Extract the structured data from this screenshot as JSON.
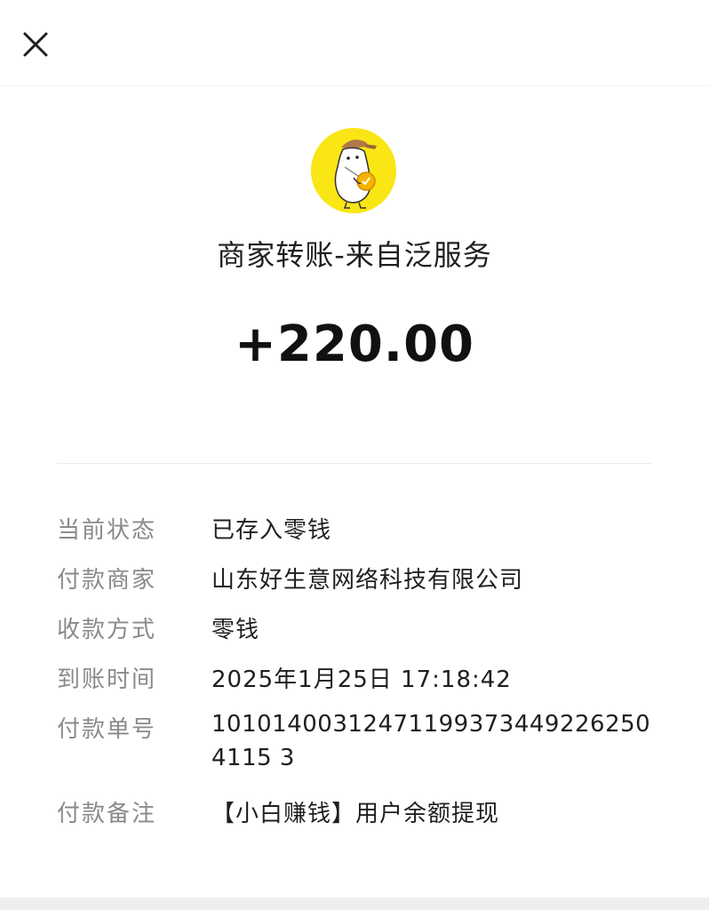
{
  "header": {
    "close_icon": "close-icon"
  },
  "merchant": {
    "avatar_icon": "merchant-mascot-avatar",
    "avatar_bg": "#f9e614",
    "title": "商家转账-来自泛服务"
  },
  "amount": "+220.00",
  "details": {
    "status": {
      "label": "当前状态",
      "value": "已存入零钱"
    },
    "payer": {
      "label": "付款商家",
      "value": "山东好生意网络科技有限公司"
    },
    "method": {
      "label": "收款方式",
      "value": "零钱"
    },
    "time": {
      "label": "到账时间",
      "value": "2025年1月25日 17:18:42"
    },
    "order_no": {
      "label": "付款单号",
      "value": "101014003124711993734492262504115 3"
    },
    "remark": {
      "label": "付款备注",
      "value": "【小白赚钱】用户余额提现"
    }
  }
}
